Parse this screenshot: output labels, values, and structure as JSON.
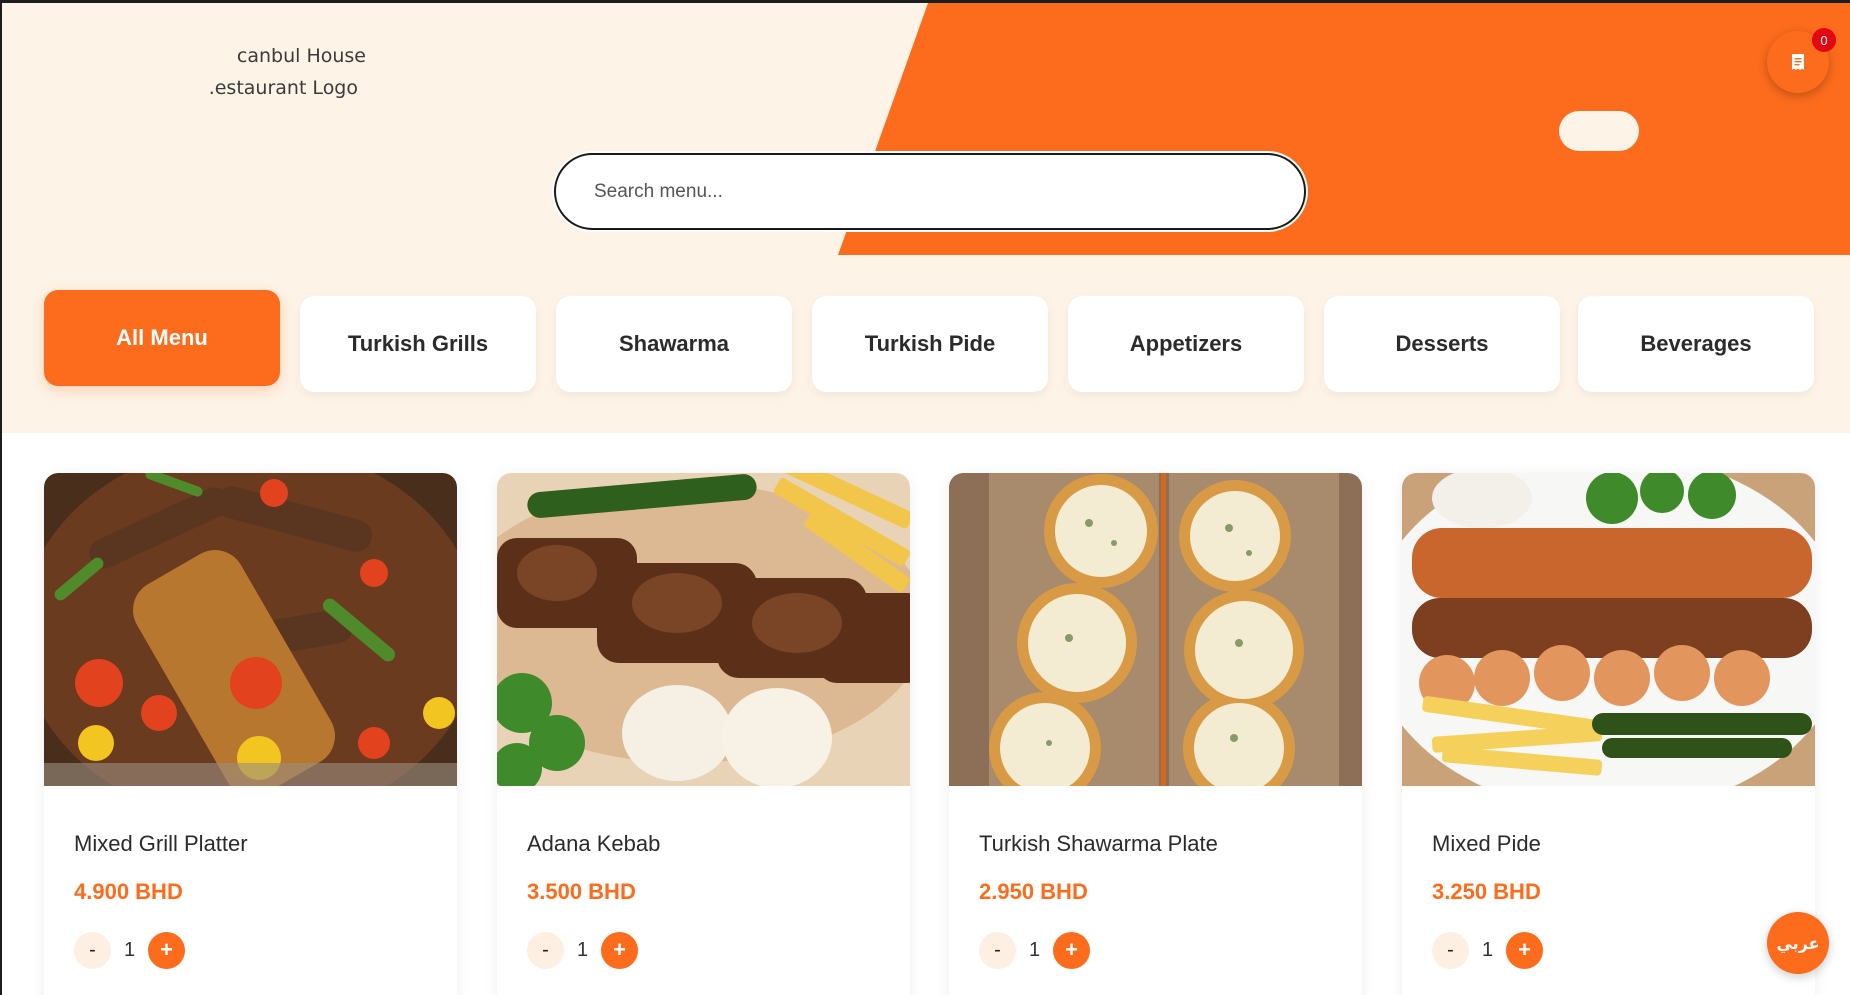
{
  "brand": {
    "logo_alt_line1": "ᴄanbul House",
    "logo_alt_line2": ".estaurant Logo"
  },
  "search": {
    "placeholder": "Search menu..."
  },
  "cart": {
    "icon": "receipt-icon",
    "count": "0"
  },
  "categories": [
    {
      "label": "All Menu",
      "active": true
    },
    {
      "label": "Turkish Grills",
      "active": false
    },
    {
      "label": "Shawarma",
      "active": false
    },
    {
      "label": "Turkish Pide",
      "active": false
    },
    {
      "label": "Appetizers",
      "active": false
    },
    {
      "label": "Desserts",
      "active": false
    },
    {
      "label": "Beverages",
      "active": false
    }
  ],
  "products": [
    {
      "name": "Mixed Grill Platter",
      "price": "4.900 BHD",
      "qty": "1",
      "minus": "-",
      "plus": "+"
    },
    {
      "name": "Adana Kebab",
      "price": "3.500 BHD",
      "qty": "1",
      "minus": "-",
      "plus": "+"
    },
    {
      "name": "Turkish Shawarma Plate",
      "price": "2.950 BHD",
      "qty": "1",
      "minus": "-",
      "plus": "+"
    },
    {
      "name": "Mixed Pide",
      "price": "3.250 BHD",
      "qty": "1",
      "minus": "-",
      "plus": "+"
    }
  ],
  "language_toggle": "عربي",
  "colors": {
    "accent": "#fd6c1c",
    "hero_bg": "#fdf3e6",
    "badge": "#e30613",
    "text_dark": "#2b2b2b"
  }
}
